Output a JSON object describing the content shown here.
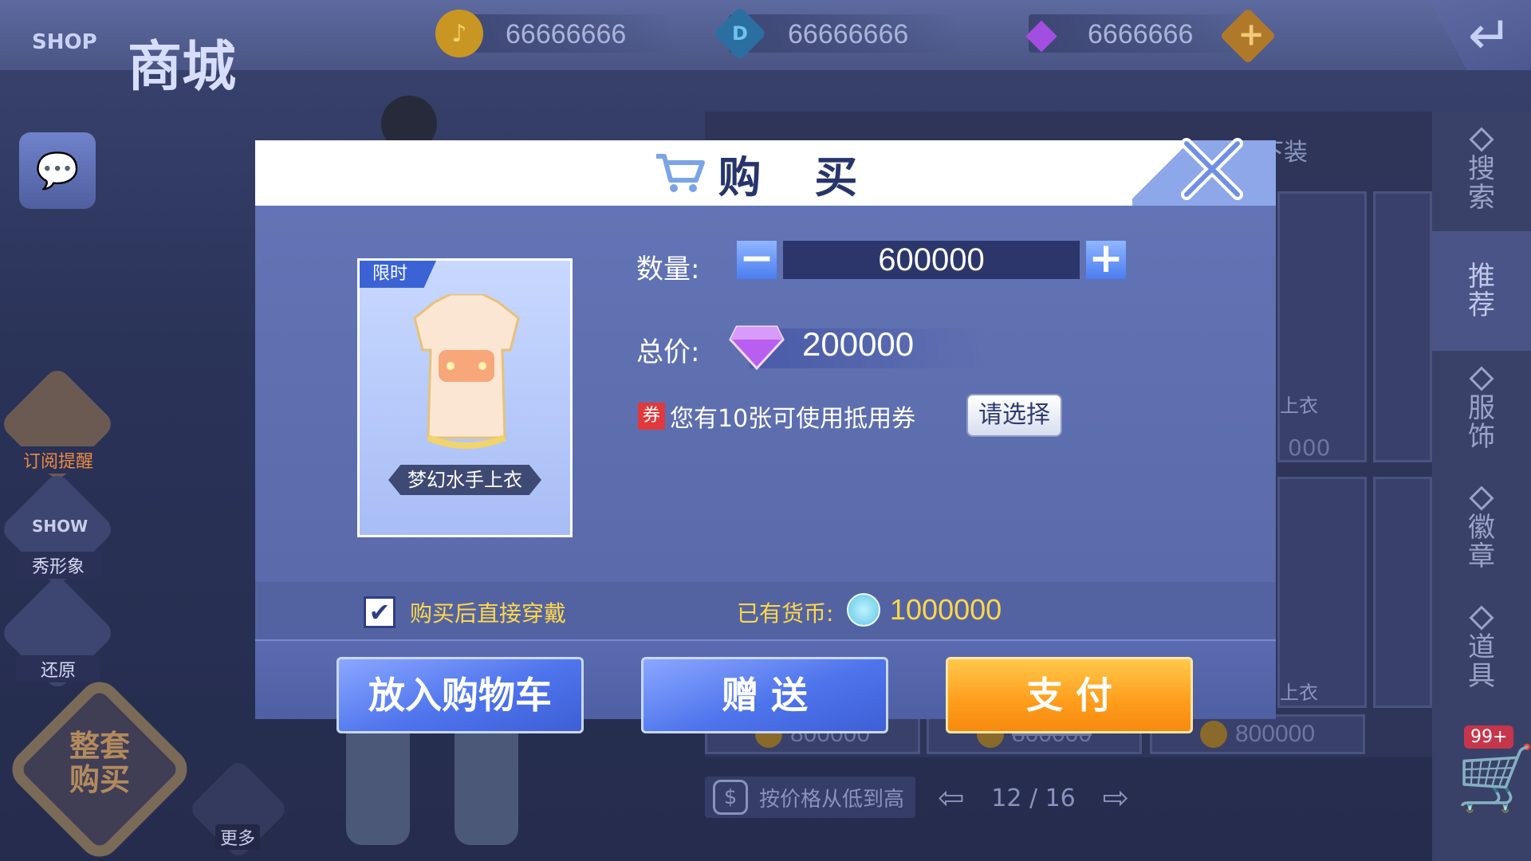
{
  "shop": {
    "logo_text": "SHOP",
    "title": "商城",
    "currencies": [
      {
        "icon": "gold-coin-icon",
        "value": "66666666",
        "color": "#d2a22b"
      },
      {
        "icon": "d-coin-icon",
        "value": "66666666",
        "color": "#2a7fb0"
      },
      {
        "icon": "diamond-icon",
        "value": "6666666",
        "color": "#9a3ed0"
      }
    ]
  },
  "left_menu": {
    "subscribe_label": "订阅提醒",
    "show_label": "秀形象",
    "show_icon_text": "SHOW",
    "restore_label": "还原",
    "whole_buy_label": "整套购买",
    "more_label": "更多"
  },
  "right_tabs": [
    {
      "label": "搜索",
      "active": false
    },
    {
      "label": "推荐",
      "active": true
    },
    {
      "label": "服饰",
      "active": false
    },
    {
      "label": "徽章",
      "active": false
    },
    {
      "label": "道具",
      "active": false
    }
  ],
  "top_filter_tabs": {
    "bottom_label": "下装"
  },
  "cart": {
    "badge": "99+"
  },
  "grid": {
    "partial_labels": [
      "上衣",
      "000",
      "上衣"
    ],
    "prices": [
      "800000",
      "800000",
      "800000"
    ],
    "sort_label": "按价格从低到高",
    "page": "12 / 16"
  },
  "modal": {
    "title": "购 买",
    "limited_badge": "限时",
    "item_name": "梦幻水手上衣",
    "quantity_label": "数量:",
    "quantity": "600000",
    "total_label": "总价:",
    "total_price": "200000",
    "coupon_tag": "券",
    "coupon_text": "您有10张可使用抵用券",
    "choose_label": "请选择",
    "wear_after_buy": "购买后直接穿戴",
    "wear_checked": true,
    "owned_label": "已有货币:",
    "owned_amount": "1000000",
    "buttons": {
      "add_to_cart": "放入购物车",
      "gift": "赠 送",
      "pay": "支 付"
    }
  }
}
